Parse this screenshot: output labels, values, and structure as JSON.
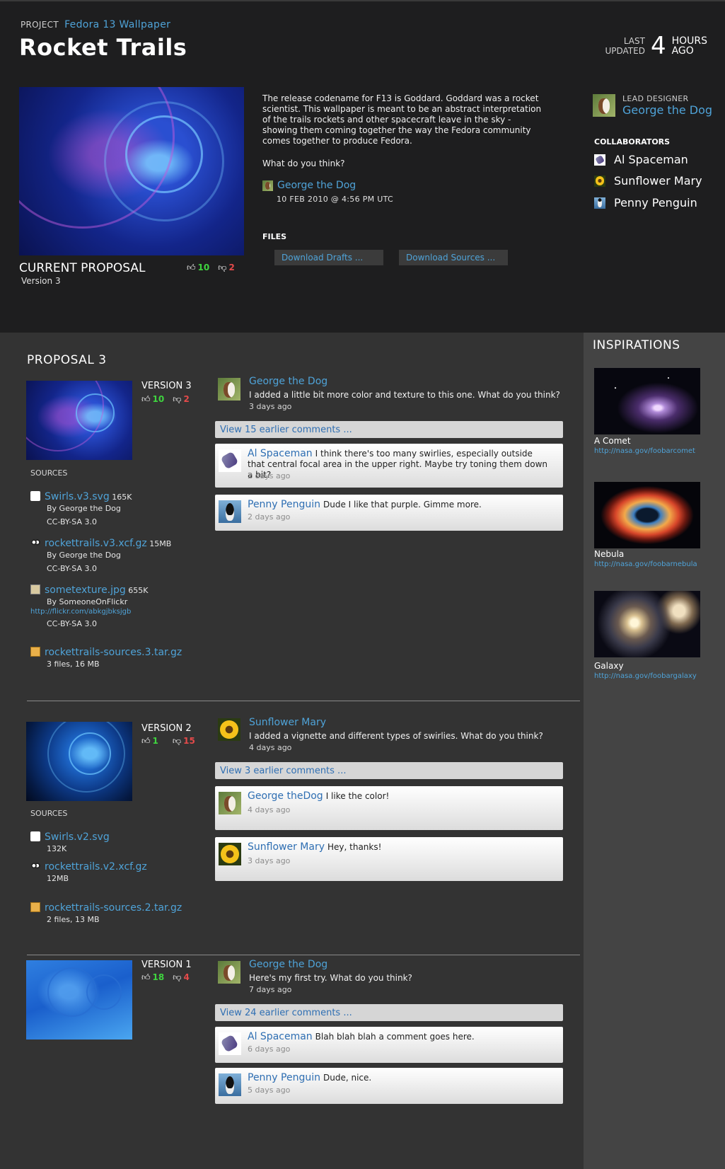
{
  "header": {
    "project_label": "PROJECT",
    "project_name": "Fedora 13 Wallpaper",
    "title": "Rocket Trails",
    "last_updated_label_1": "LAST",
    "last_updated_label_2": "UPDATED",
    "last_updated_value": "4",
    "last_updated_unit_1": "HOURS",
    "last_updated_unit_2": "AGO"
  },
  "current": {
    "label": "CURRENT PROPOSAL",
    "version": "Version 3",
    "up": "10",
    "down": "2"
  },
  "description": {
    "text": "The release codename for F13 is Goddard. Goddard was a rocket scientist. This wallpaper is meant to be an abstract interpretation of the trails rockets and other spacecraft leave in the sky - showing them coming together the way the Fedora community comes together to produce Fedora.",
    "question": "What do you think?",
    "author": "George the Dog",
    "date": "10 FEB 2010 @ 4:56 PM UTC"
  },
  "files": {
    "heading": "FILES",
    "drafts_label": "Download Drafts ...",
    "sources_label": "Download Sources ..."
  },
  "people": {
    "lead_label": "LEAD DESIGNER",
    "lead_name": "George the Dog",
    "collab_heading": "COLLABORATORS",
    "collaborators": [
      "Al Spaceman",
      "Sunflower Mary",
      "Penny Penguin"
    ]
  },
  "proposal_title": "PROPOSAL  3",
  "versions": [
    {
      "label": "VERSION 3",
      "up": "10",
      "down": "2",
      "sources_heading": "SOURCES",
      "sources": [
        {
          "name": "Swirls.v3.svg",
          "size": "165K",
          "by": "By George the Dog",
          "license": "CC-BY-SA 3.0"
        },
        {
          "name": "rockettrails.v3.xcf.gz",
          "size": "15MB",
          "by": "By George the Dog",
          "license": "CC-BY-SA 3.0"
        },
        {
          "name": "sometexture.jpg",
          "size": "655K",
          "by": "By SomeoneOnFlickr",
          "url": "http://flickr.com/abkgjbksjgb",
          "license": "CC-BY-SA 3.0"
        }
      ],
      "archive": {
        "name": "rockettrails-sources.3.tar.gz",
        "info": "3 files, 16 MB"
      },
      "head_comment": {
        "author": "George the Dog",
        "text": "I added a little bit more color and texture to this one. What do you think?",
        "time": "3 days ago"
      },
      "view_earlier": "View 15 earlier comments ...",
      "comments": [
        {
          "author": "Al Spaceman",
          "text": "I think there's too many swirlies, especially outside that central focal area in the upper right. Maybe try toning them down a bit?",
          "time": "2 days ago"
        },
        {
          "author": "Penny Penguin",
          "text": "Dude I like that purple. Gimme more.",
          "time": "2 days ago"
        }
      ]
    },
    {
      "label": "VERSION 2",
      "up": "1",
      "down": "15",
      "sources_heading": "SOURCES",
      "sources": [
        {
          "name": "Swirls.v2.svg",
          "size": "132K"
        },
        {
          "name": "rockettrails.v2.xcf.gz",
          "size": "12MB"
        }
      ],
      "archive": {
        "name": "rockettrails-sources.2.tar.gz",
        "info": "2 files, 13 MB"
      },
      "head_comment": {
        "author": "Sunflower Mary",
        "text": "I added a vignette and different types of swirlies. What do you think?",
        "time": "4 days ago"
      },
      "view_earlier": "View 3 earlier comments ...",
      "comments": [
        {
          "author": "George theDog",
          "text": "I like the color!",
          "time": "4 days ago"
        },
        {
          "author": "Sunflower Mary",
          "text": "Hey, thanks!",
          "time": "3 days ago"
        }
      ]
    },
    {
      "label": "VERSION 1",
      "up": "18",
      "down": "4",
      "head_comment": {
        "author": "George the Dog",
        "text": "Here's my first try. What do you think?",
        "time": "7 days ago"
      },
      "view_earlier": "View 24 earlier comments ...",
      "comments": [
        {
          "author": "Al Spaceman",
          "text": "Blah blah blah a comment goes here.",
          "time": "6 days ago"
        },
        {
          "author": "Penny Penguin",
          "text": "Dude, nice.",
          "time": "5 days ago"
        }
      ]
    }
  ],
  "inspirations": {
    "title": "INSPIRATIONS",
    "items": [
      {
        "caption": "A Comet",
        "url": "http://nasa.gov/foobarcomet"
      },
      {
        "caption": "Nebula",
        "url": "http://nasa.gov/foobarnebula"
      },
      {
        "caption": "Galaxy",
        "url": "http://nasa.gov/foobargalaxy"
      }
    ]
  },
  "colors": {
    "accent": "#4fa3d8",
    "vote_up": "#3fd43f",
    "vote_down": "#e44a4a",
    "header_bg": "#1e1e1f",
    "body_bg": "#333333",
    "sidebar_bg": "#444444"
  }
}
